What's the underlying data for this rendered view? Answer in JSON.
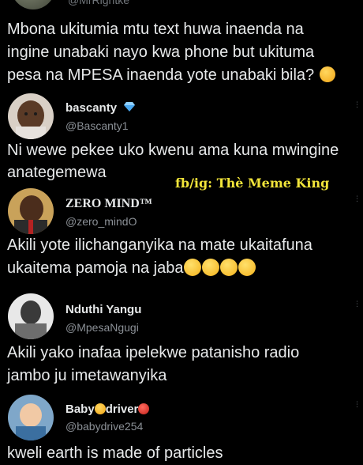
{
  "top_tweet": {
    "handle": "@MrRightke",
    "text_lines": [
      "Mbona ukitumia mtu text huwa inaenda na",
      "ingine unabaki nayo kwa phone but ukituma",
      "pesa na MPESA inaenda yote unabaki bila?"
    ],
    "trailing_emoji": "thinking-face-icon"
  },
  "watermark": "fb/ig: Thè Meme King",
  "replies": [
    {
      "display_name": "bascanty",
      "badge": "diamond-icon",
      "handle": "@Bascanty1",
      "text_lines": [
        "Ni wewe pekee uko kwenu ama kuna mwingine",
        "anategemewa"
      ]
    },
    {
      "display_name": "ZERO MIND™",
      "handle": "@zero_mindO",
      "text_lines": [
        "Akili yote ilichanganyika na mate ukaitafuna",
        "ukaitema pamoja na jaba"
      ],
      "trailing_emojis": [
        "tears-of-joy-icon",
        "tears-of-joy-icon",
        "tears-of-joy-icon",
        "tears-of-joy-icon"
      ]
    },
    {
      "display_name": "Nduthi Yangu",
      "handle": "@MpesaNgugi",
      "text_lines": [
        "Akili yako inafaa ipelekwe patanisho radio",
        "jambo ju imetawanyika"
      ]
    },
    {
      "display_name_parts": [
        "Baby",
        "driver"
      ],
      "name_emojis": [
        "sunglasses-face-icon",
        "angry-face-icon"
      ],
      "handle": "@babydrive254",
      "text_lines": [
        "kweli earth is made of particles"
      ]
    }
  ],
  "more_glyph": "⋮",
  "colors": {
    "background": "#000000",
    "text": "#e7e9ea",
    "secondary": "#8b9096",
    "watermark": "#f2e53a",
    "verified": "#1d9bf0"
  }
}
